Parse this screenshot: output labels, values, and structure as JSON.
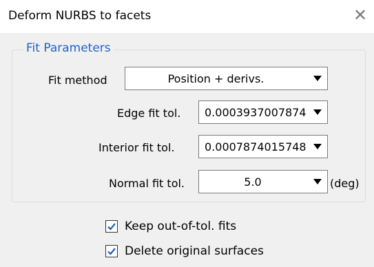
{
  "window": {
    "title": "Deform NURBS to facets",
    "close_glyph": "✕"
  },
  "fit_parameters": {
    "group_label": "Fit Parameters",
    "fit_method": {
      "label": "Fit method",
      "value": "Position + derivs."
    },
    "edge_fit_tol": {
      "label": "Edge fit tol.",
      "value": "0.0003937007874"
    },
    "interior_fit_tol": {
      "label": "Interior fit tol.",
      "value": "0.0007874015748"
    },
    "normal_fit_tol": {
      "label": "Normal fit tol.",
      "value": "5.0",
      "unit": "(deg)"
    }
  },
  "options": {
    "keep_out_of_tol": {
      "label": "Keep out-of-tol. fits",
      "checked": true
    },
    "delete_original": {
      "label": "Delete original surfaces",
      "checked": true
    }
  },
  "colors": {
    "accent": "#1e63c8",
    "check": "#1f5fb4"
  }
}
